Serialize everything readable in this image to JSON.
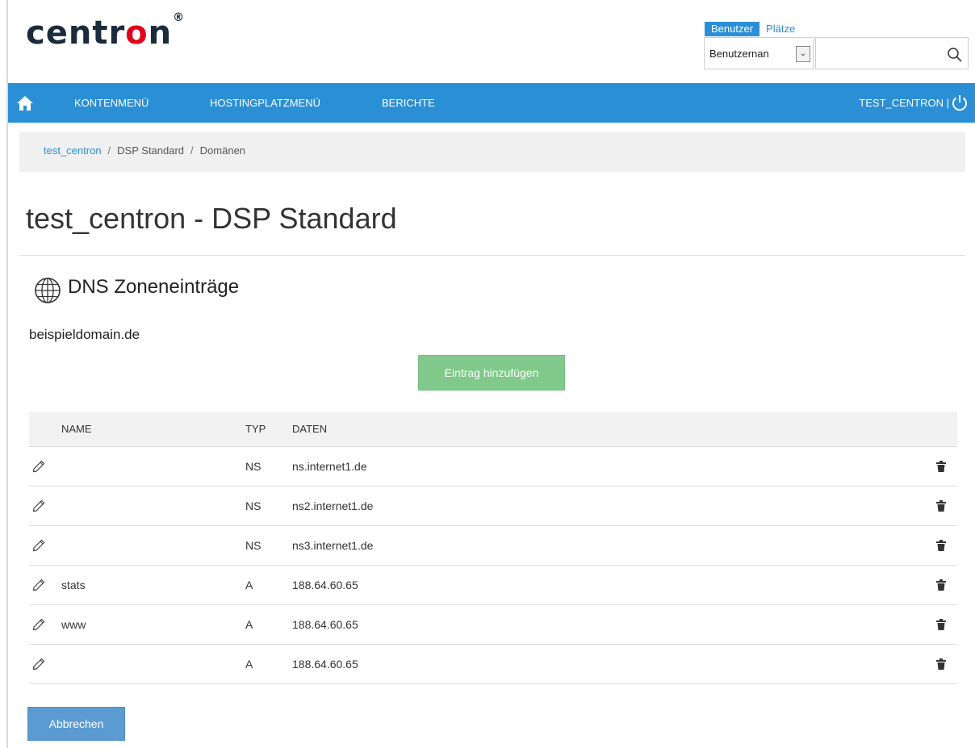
{
  "logo": {
    "text_before": "centr",
    "text_o": "o",
    "text_after": "n",
    "registered": "®"
  },
  "search": {
    "tabs": [
      {
        "label": "Benutzer",
        "active": true
      },
      {
        "label": "Plätze",
        "active": false
      }
    ],
    "select_value": "Benutzernan",
    "input_value": "",
    "icon": "search-icon"
  },
  "nav": {
    "home_icon": "home-icon",
    "items": [
      {
        "label": "KONTENMENÜ"
      },
      {
        "label": "HOSTINGPLATZMENÜ"
      },
      {
        "label": "BERICHTE"
      }
    ],
    "user_label": "TEST_CENTRON |",
    "power_icon": "power-icon",
    "color": "#2b8fd6"
  },
  "breadcrumb": {
    "items": [
      "test_centron",
      "DSP Standard",
      "Domänen"
    ],
    "separator": "/"
  },
  "page": {
    "title": "test_centron - DSP Standard"
  },
  "section": {
    "icon": "globe-icon",
    "title": "DNS Zoneneinträge",
    "domain": "beispieldomain.de"
  },
  "buttons": {
    "add_label": "Eintrag hinzufügen",
    "cancel_label": "Abbrechen",
    "add_color": "#80c98a",
    "cancel_color": "#5b9bd1"
  },
  "table": {
    "columns": {
      "name": "NAME",
      "type": "TYP",
      "data": "DATEN"
    },
    "rows": [
      {
        "name": "",
        "type": "NS",
        "data": "ns.internet1.de"
      },
      {
        "name": "",
        "type": "NS",
        "data": "ns2.internet1.de"
      },
      {
        "name": "",
        "type": "NS",
        "data": "ns3.internet1.de"
      },
      {
        "name": "stats",
        "type": "A",
        "data": "188.64.60.65"
      },
      {
        "name": "www",
        "type": "A",
        "data": "188.64.60.65"
      },
      {
        "name": "",
        "type": "A",
        "data": "188.64.60.65"
      }
    ],
    "row_icons": {
      "edit": "pencil-icon",
      "delete": "trash-icon"
    }
  }
}
